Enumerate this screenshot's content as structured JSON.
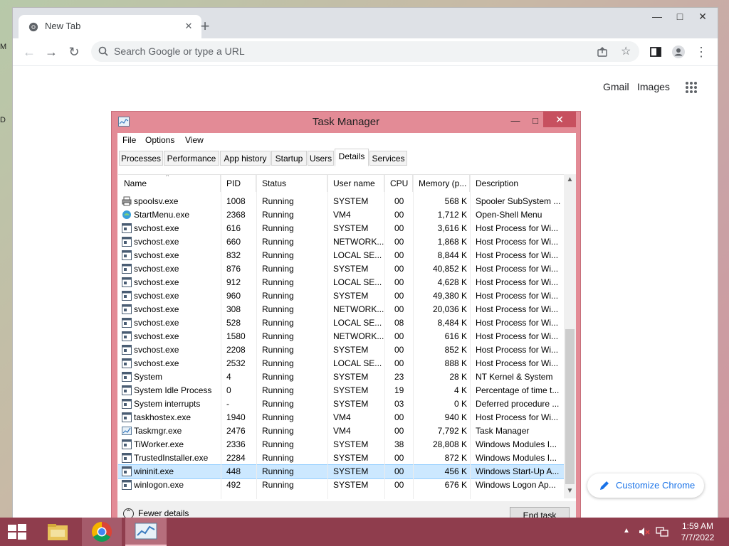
{
  "colors": {
    "chrome_blue": "#1a73e8",
    "task_manager_frame": "#e38b96",
    "close_red": "#c7505f",
    "taskbar": "#8f3d4d",
    "selection": "#cce8ff"
  },
  "desktop": {
    "edge_letters": [
      "M",
      "D"
    ]
  },
  "browser": {
    "tab_title": "New Tab",
    "tab_icon": "chrome-icon",
    "new_tab_symbol": "+",
    "window_controls": {
      "minimize": "—",
      "maximize": "□",
      "close": "✕"
    },
    "omnibox_placeholder": "Search Google or type a URL",
    "links": {
      "gmail": "Gmail",
      "images": "Images"
    },
    "customize_label": "Customize Chrome"
  },
  "task_manager": {
    "title": "Task Manager",
    "window_controls": {
      "minimize": "—",
      "maximize": "□",
      "close": "✕"
    },
    "menu": [
      "File",
      "Options",
      "View"
    ],
    "tabs": [
      "Processes",
      "Performance",
      "App history",
      "Startup",
      "Users",
      "Details",
      "Services"
    ],
    "active_tab": "Details",
    "columns": [
      "Name",
      "PID",
      "Status",
      "User name",
      "CPU",
      "Memory (p...",
      "Description"
    ],
    "rows": [
      {
        "name": "spoolsv.exe",
        "pid": "1008",
        "status": "Running",
        "user": "SYSTEM",
        "cpu": "00",
        "mem": "568 K",
        "desc": "Spooler SubSystem ...",
        "icon": "printer-icon"
      },
      {
        "name": "StartMenu.exe",
        "pid": "2368",
        "status": "Running",
        "user": "VM4",
        "cpu": "00",
        "mem": "1,712 K",
        "desc": "Open-Shell Menu",
        "icon": "shell-icon"
      },
      {
        "name": "svchost.exe",
        "pid": "616",
        "status": "Running",
        "user": "SYSTEM",
        "cpu": "00",
        "mem": "3,616 K",
        "desc": "Host Process for Wi...",
        "icon": "process-icon"
      },
      {
        "name": "svchost.exe",
        "pid": "660",
        "status": "Running",
        "user": "NETWORK...",
        "cpu": "00",
        "mem": "1,868 K",
        "desc": "Host Process for Wi...",
        "icon": "process-icon"
      },
      {
        "name": "svchost.exe",
        "pid": "832",
        "status": "Running",
        "user": "LOCAL SE...",
        "cpu": "00",
        "mem": "8,844 K",
        "desc": "Host Process for Wi...",
        "icon": "process-icon"
      },
      {
        "name": "svchost.exe",
        "pid": "876",
        "status": "Running",
        "user": "SYSTEM",
        "cpu": "00",
        "mem": "40,852 K",
        "desc": "Host Process for Wi...",
        "icon": "process-icon"
      },
      {
        "name": "svchost.exe",
        "pid": "912",
        "status": "Running",
        "user": "LOCAL SE...",
        "cpu": "00",
        "mem": "4,628 K",
        "desc": "Host Process for Wi...",
        "icon": "process-icon"
      },
      {
        "name": "svchost.exe",
        "pid": "960",
        "status": "Running",
        "user": "SYSTEM",
        "cpu": "00",
        "mem": "49,380 K",
        "desc": "Host Process for Wi...",
        "icon": "process-icon"
      },
      {
        "name": "svchost.exe",
        "pid": "308",
        "status": "Running",
        "user": "NETWORK...",
        "cpu": "00",
        "mem": "20,036 K",
        "desc": "Host Process for Wi...",
        "icon": "process-icon"
      },
      {
        "name": "svchost.exe",
        "pid": "528",
        "status": "Running",
        "user": "LOCAL SE...",
        "cpu": "08",
        "mem": "8,484 K",
        "desc": "Host Process for Wi...",
        "icon": "process-icon"
      },
      {
        "name": "svchost.exe",
        "pid": "1580",
        "status": "Running",
        "user": "NETWORK...",
        "cpu": "00",
        "mem": "616 K",
        "desc": "Host Process for Wi...",
        "icon": "process-icon"
      },
      {
        "name": "svchost.exe",
        "pid": "2208",
        "status": "Running",
        "user": "SYSTEM",
        "cpu": "00",
        "mem": "852 K",
        "desc": "Host Process for Wi...",
        "icon": "process-icon"
      },
      {
        "name": "svchost.exe",
        "pid": "2532",
        "status": "Running",
        "user": "LOCAL SE...",
        "cpu": "00",
        "mem": "888 K",
        "desc": "Host Process for Wi...",
        "icon": "process-icon"
      },
      {
        "name": "System",
        "pid": "4",
        "status": "Running",
        "user": "SYSTEM",
        "cpu": "23",
        "mem": "28 K",
        "desc": "NT Kernel & System",
        "icon": "process-icon"
      },
      {
        "name": "System Idle Process",
        "pid": "0",
        "status": "Running",
        "user": "SYSTEM",
        "cpu": "19",
        "mem": "4 K",
        "desc": "Percentage of time t...",
        "icon": "process-icon"
      },
      {
        "name": "System interrupts",
        "pid": "-",
        "status": "Running",
        "user": "SYSTEM",
        "cpu": "03",
        "mem": "0 K",
        "desc": "Deferred procedure ...",
        "icon": "process-icon"
      },
      {
        "name": "taskhostex.exe",
        "pid": "1940",
        "status": "Running",
        "user": "VM4",
        "cpu": "00",
        "mem": "940 K",
        "desc": "Host Process for Wi...",
        "icon": "process-icon"
      },
      {
        "name": "Taskmgr.exe",
        "pid": "2476",
        "status": "Running",
        "user": "VM4",
        "cpu": "00",
        "mem": "7,792 K",
        "desc": "Task Manager",
        "icon": "taskmgr-icon"
      },
      {
        "name": "TiWorker.exe",
        "pid": "2336",
        "status": "Running",
        "user": "SYSTEM",
        "cpu": "38",
        "mem": "28,808 K",
        "desc": "Windows Modules I...",
        "icon": "process-icon"
      },
      {
        "name": "TrustedInstaller.exe",
        "pid": "2284",
        "status": "Running",
        "user": "SYSTEM",
        "cpu": "00",
        "mem": "872 K",
        "desc": "Windows Modules I...",
        "icon": "process-icon"
      },
      {
        "name": "wininit.exe",
        "pid": "448",
        "status": "Running",
        "user": "SYSTEM",
        "cpu": "00",
        "mem": "456 K",
        "desc": "Windows Start-Up A...",
        "icon": "process-icon",
        "selected": true
      },
      {
        "name": "winlogon.exe",
        "pid": "492",
        "status": "Running",
        "user": "SYSTEM",
        "cpu": "00",
        "mem": "676 K",
        "desc": "Windows Logon Ap...",
        "icon": "process-icon"
      }
    ],
    "fewer_details": "Fewer details",
    "end_task": "End task"
  },
  "taskbar": {
    "start_icon": "windows-start-icon",
    "items": [
      "file-explorer-icon",
      "chrome-icon",
      "task-manager-icon"
    ],
    "tray_icons": [
      "show-hidden-icons-icon",
      "volume-muted-icon",
      "network-icon"
    ],
    "time": "1:59 AM",
    "date": "7/7/2022"
  }
}
